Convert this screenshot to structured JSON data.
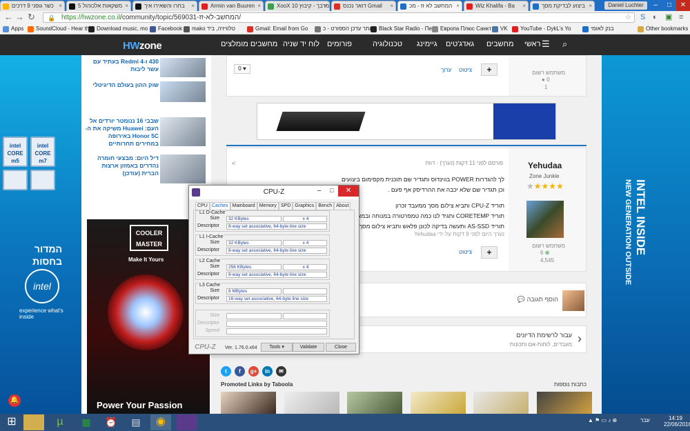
{
  "browser": {
    "tabs": [
      {
        "label": "כשר גופני 9 דרכים",
        "color": "#ffb400",
        "active": false
      },
      {
        "label": "5 משקאות אלכוהול",
        "color": "#111111",
        "active": false
      },
      {
        "label": "בחרו והשאירו איך",
        "color": "#111111",
        "active": false
      },
      {
        "label": "Armin van Buuren",
        "color": "#e02020",
        "active": false
      },
      {
        "label": "XooX 10 מרבך - קיבוץ",
        "color": "#3aa14a",
        "active": false
      },
      {
        "label": "דואר נכנס Gmail",
        "color": "#d93025",
        "active": false
      },
      {
        "label": "המחשב לא זז - מכ",
        "color": "#1f6fc6",
        "active": true
      },
      {
        "label": "Wiz Khalifa - Ba",
        "color": "#e02020",
        "active": false
      },
      {
        "label": "ביצוע לבדיקת מסך",
        "color": "#1f6fc6",
        "active": false
      }
    ],
    "user": "Daniel Luchter",
    "url_host": "https://hwzone.co.il",
    "url_path": "/community/topic/569031-המחשב-לא-זז/",
    "bookmarks": [
      {
        "label": "Apps",
        "color": "#5a8fd8"
      },
      {
        "label": "SoundCloud - Hear th",
        "color": "#ff6a00"
      },
      {
        "label": "Download music, mo",
        "color": "#222222"
      },
      {
        "label": "Facebook",
        "color": "#3b5998"
      },
      {
        "label": "mako טלוויזיה, ביד",
        "color": "#555555"
      },
      {
        "label": "Gmail: Email from Go",
        "color": "#d93025"
      },
      {
        "label": "אתר עדכן הספורט - כ",
        "color": "#777777"
      },
      {
        "label": "Black Star Radio - Пер",
        "color": "#222222"
      },
      {
        "label": "Европа Плюс Санкт",
        "color": "#888888"
      },
      {
        "label": "VK",
        "color": "#4a76a8"
      },
      {
        "label": "YouTube - DykL's Yo",
        "color": "#e02020"
      },
      {
        "label": "בנק לאומי",
        "color": "#1f6fc6"
      },
      {
        "label": "Other bookmarks",
        "color": "#d7a84a"
      }
    ]
  },
  "site": {
    "logo_a": "HW",
    "logo_b": "zone",
    "nav": [
      "ראשי",
      "מחשבים",
      "גאדג'טים",
      "גיימינג",
      "טכנולוגיה",
      "פורומים",
      "לוח יד שניה",
      "מחשבים מומלצים"
    ]
  },
  "sidebar": {
    "items": [
      {
        "text": "430 ו-Redmi 4 בעתיד עם עשר ליבות"
      },
      {
        "text": "שוק ההון בעולם הדיגיטלי"
      },
      {
        "text": "שבבי 16 ננומטר יורדים אל העם: Huawei משיקה את ה-Honor 5C באירופה במחירים תחרותיים"
      },
      {
        "text": "דיל היום: מבצעי חומרה נהדרים באמזון ארצות הברית (עודכן)"
      }
    ],
    "ad_brand": "COOLER MASTER",
    "ad_tag": "Make It Yours",
    "ad_bottom": "Power Your Passion"
  },
  "left_banner": {
    "chip1": "intel CORE m5",
    "chip2": "intel CORE m7",
    "slogan": "המדור בחסות",
    "brand": "intel",
    "sub": "experience what's inside"
  },
  "right_banner": {
    "line1": "INTEL INSIDE",
    "line2": "NEW GENERATION OUTSIDE"
  },
  "post1": {
    "like_count": "0",
    "quote": "ציטוט",
    "edit": "ערוך",
    "rank": "משתמש רשום",
    "rep": "0",
    "posts": "1"
  },
  "post2": {
    "author": "Yehudaa",
    "title": "Zone Junkie",
    "rank": "משתמש רשום",
    "rep": "6",
    "posts": "4,545",
    "meta": "פורסם לפני 11 דקות (נערך) · דווח",
    "lines": [
      "לך להגדרות POWER בווינדוס ותגדיר שם תוכנית מקסימום ביצועים",
      "וכן תגדיר שם שלא יכבה את ההרדיסק אף פעם .",
      "תוריד CPU-Z ותביא צילום מסך ממעבד זכרון",
      "תוריד CORETEMP ותגיד לנו כמה טמפרטורה במנוחה ובמאמץ",
      "תוריד AS-SSD ותעשה בדיקה לכונן פלאש ותביא צילום מסך"
    ],
    "edited_note": "נערך היום לפני 9 דקות על-ידי Yehudaa",
    "quote": "ציטוט"
  },
  "reply": {
    "label": "הוסף תגובה"
  },
  "pager": {
    "title": "עבור לרשימת הדיונים",
    "sub": "מעבדים, לוחות-אם ותכונות"
  },
  "taboola": {
    "label": "Promoted Links by Taboola",
    "related": "כתבות נוספות"
  },
  "cpuz": {
    "title": "CPU-Z",
    "tabs": [
      "CPU",
      "Caches",
      "Mainboard",
      "Memory",
      "SPD",
      "Graphics",
      "Bench",
      "About"
    ],
    "selected_tab": "Caches",
    "groups": [
      {
        "label": "L1 D-Cache",
        "size": "32 KBytes",
        "mult": "x 4",
        "desc": "8-way set associative, 64-byte line size"
      },
      {
        "label": "L1 I-Cache",
        "size": "32 KBytes",
        "mult": "x 4",
        "desc": "8-way set associative, 64-byte line size"
      },
      {
        "label": "L2 Cache",
        "size": "256 KBytes",
        "mult": "x 4",
        "desc": "8-way set associative, 64-byte line size"
      },
      {
        "label": "L3 Cache",
        "size": "8 MBytes",
        "mult": "",
        "desc": "16-way set associative, 64-byte line size"
      }
    ],
    "size_label": "Size",
    "desc_label": "Descriptor",
    "speed_label": "Speed",
    "brand": "CPU-Z",
    "version": "Ver. 1.76.0.x64",
    "tools": "Tools",
    "validate": "Validate",
    "close": "Close"
  },
  "taskbar": {
    "lang": "עבר",
    "time": "14:19",
    "date": "22/06/2016"
  }
}
